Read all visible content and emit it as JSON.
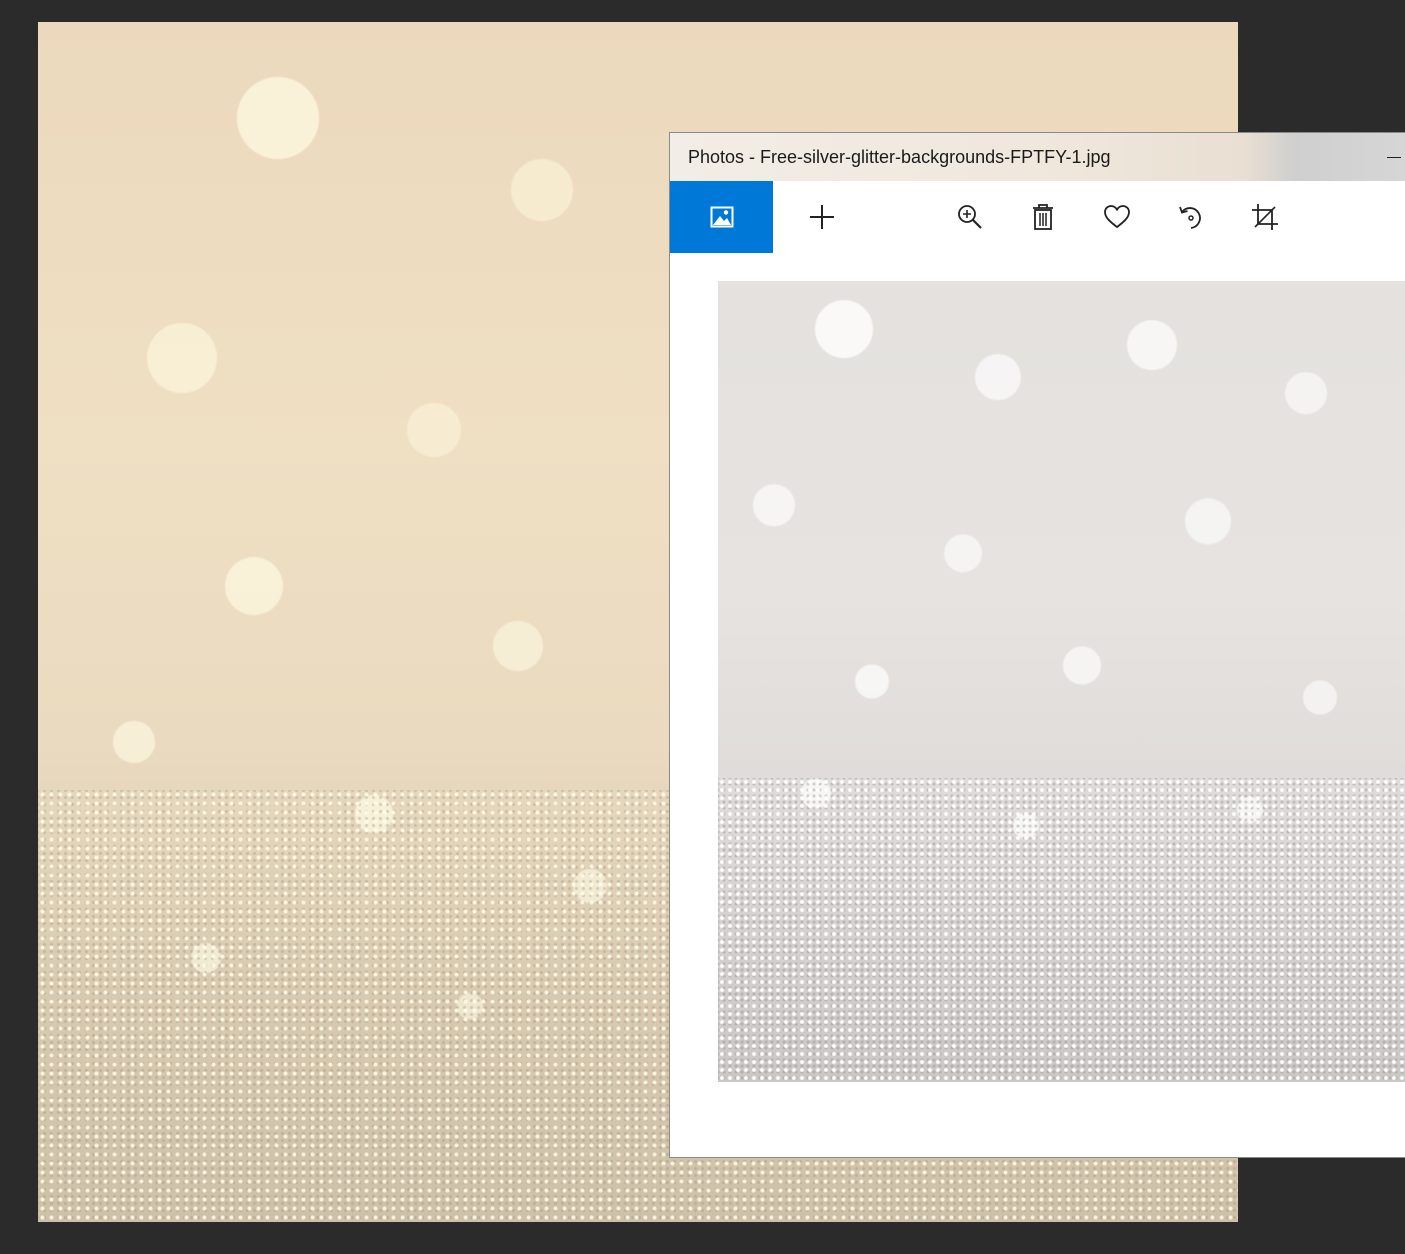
{
  "window": {
    "title": "Photos - Free-silver-glitter-backgrounds-FPTFY-1.jpg"
  },
  "toolbar": {
    "buttons": [
      {
        "name": "view-image",
        "icon": "image-icon",
        "active": true
      },
      {
        "name": "add",
        "icon": "plus-icon"
      },
      {
        "name": "zoom",
        "icon": "zoom-in-icon"
      },
      {
        "name": "delete",
        "icon": "trash-icon"
      },
      {
        "name": "favorite",
        "icon": "heart-icon"
      },
      {
        "name": "rotate",
        "icon": "rotate-icon"
      },
      {
        "name": "crop",
        "icon": "crop-icon"
      }
    ]
  },
  "colors": {
    "desktop": "#2b2b2b",
    "accent": "#0078d7",
    "window_bg": "#ffffff"
  }
}
